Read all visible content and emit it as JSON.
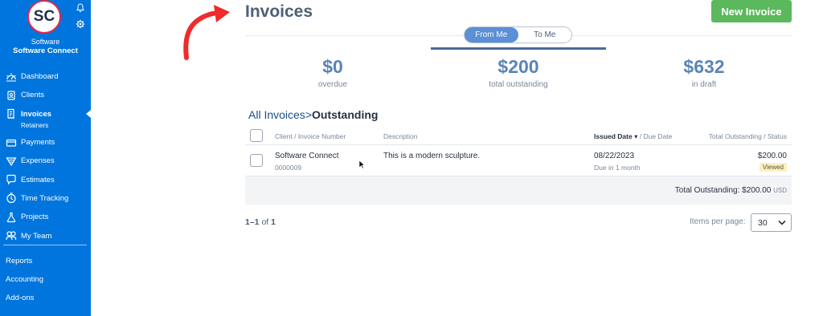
{
  "sidebar": {
    "avatar_initials": "SC",
    "business_line1": "Software",
    "business_line2": "Software Connect",
    "items": [
      {
        "label": "Dashboard",
        "icon": "dashboard-icon"
      },
      {
        "label": "Clients",
        "icon": "clients-icon"
      },
      {
        "label": "Invoices",
        "icon": "invoices-icon",
        "active": true
      },
      {
        "label": "Payments",
        "icon": "payments-icon"
      },
      {
        "label": "Expenses",
        "icon": "expenses-icon"
      },
      {
        "label": "Estimates",
        "icon": "estimates-icon"
      },
      {
        "label": "Time Tracking",
        "icon": "clock-icon"
      },
      {
        "label": "Projects",
        "icon": "projects-icon"
      },
      {
        "label": "My Team",
        "icon": "team-icon"
      }
    ],
    "sub_item": "Retainers",
    "bottom": [
      "Reports",
      "Accounting",
      "Add-ons"
    ],
    "accent": "#0075dd"
  },
  "header": {
    "title": "Invoices",
    "new_button": "New Invoice",
    "toggle": [
      "From Me",
      "To Me"
    ]
  },
  "stats": [
    {
      "value": "$0",
      "label": "overdue"
    },
    {
      "value": "$200",
      "label": "total outstanding"
    },
    {
      "value": "$632",
      "label": "in draft"
    }
  ],
  "breadcrumb": {
    "parent": "All Invoices",
    "separator": ">",
    "current": "Outstanding"
  },
  "table": {
    "headers": {
      "client": "Client / Invoice Number",
      "description": "Description",
      "issued": "Issued Date",
      "due": "/ Due Date",
      "total": "Total Outstanding / Status"
    },
    "rows": [
      {
        "client": "Software Connect",
        "number": "0000009",
        "description": "This is a modern sculpture.",
        "issued": "08/22/2023",
        "due": "Due in 1 month",
        "amount": "$200.00",
        "status": "Viewed"
      }
    ],
    "total_label": "Total Outstanding:",
    "total_value": "$200.00",
    "total_currency": "USD"
  },
  "pagination": {
    "range": "1–1",
    "of_label": "of",
    "total": "1",
    "items_per_page_label": "Items per page:",
    "items_per_page": "30"
  }
}
